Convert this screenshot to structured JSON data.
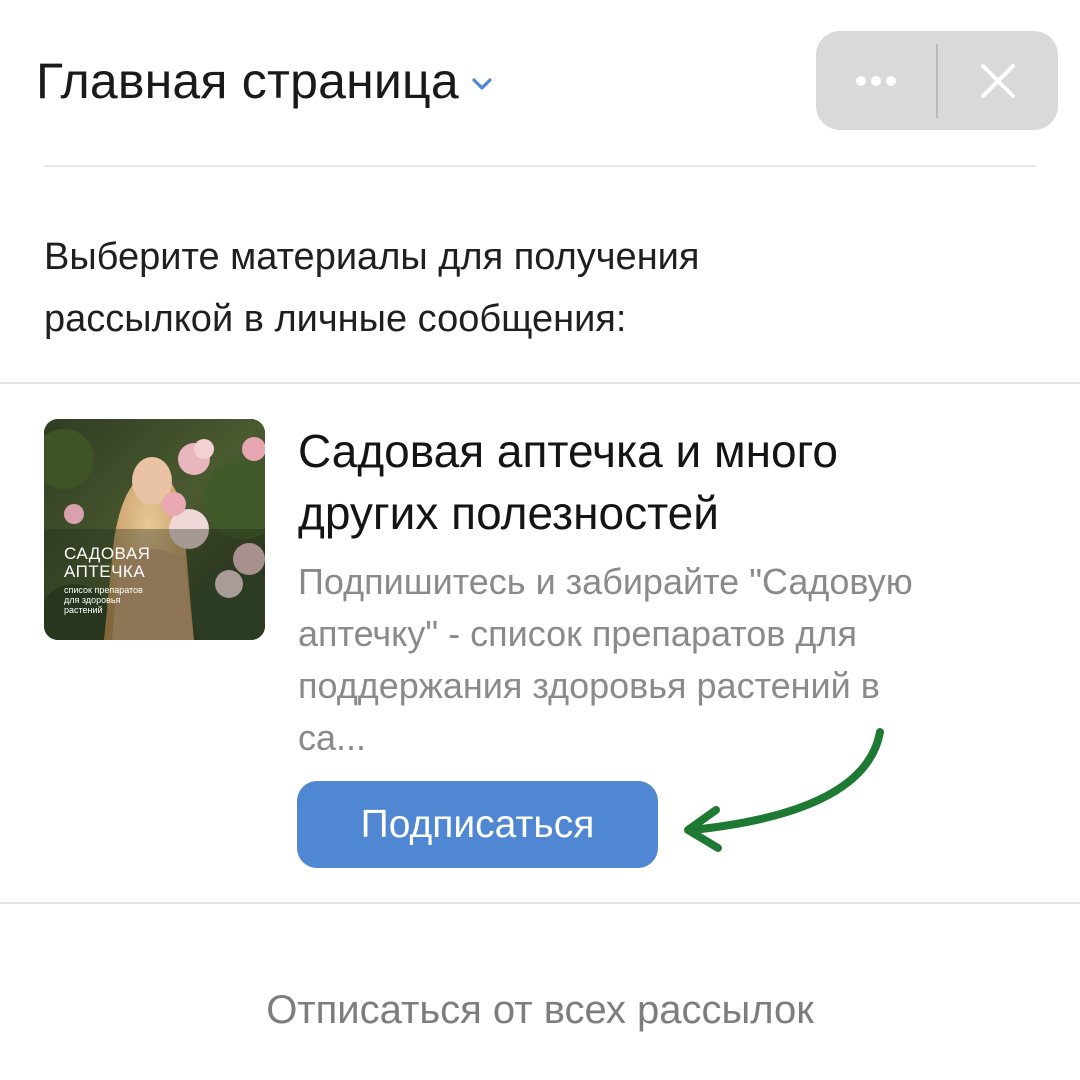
{
  "header": {
    "title": "Главная страница",
    "title_chevron_icon": "chevron-down-icon",
    "more_icon": "more-dots-icon",
    "close_icon": "close-icon",
    "chevron_color": "#4f87d2"
  },
  "intro": {
    "line1": "Выберите материалы для получения",
    "line2": "рассылкой в личные сообщения:"
  },
  "card": {
    "thumbnail": {
      "title_line1": "САДОВАЯ",
      "title_line2": "АПТЕЧКА",
      "subtitle_line1": "список препаратов",
      "subtitle_line2": "для здоровья",
      "subtitle_line3": "растений"
    },
    "title_line1": "Садовая аптечка и много",
    "title_line2": "других полезностей",
    "desc_line1": "Подпишитесь и забирайте \"Садовую",
    "desc_line2": "аптечку\" - список препаратов для",
    "desc_line3": "поддержания здоровья растений в",
    "desc_line4": "са...",
    "subscribe_label": "Подписаться",
    "subscribe_color": "#4f87d2"
  },
  "annotation": {
    "arrow_icon": "curved-arrow-icon",
    "arrow_color": "#1e7a33"
  },
  "footer": {
    "unsubscribe_label": "Отписаться от всех рассылок"
  }
}
